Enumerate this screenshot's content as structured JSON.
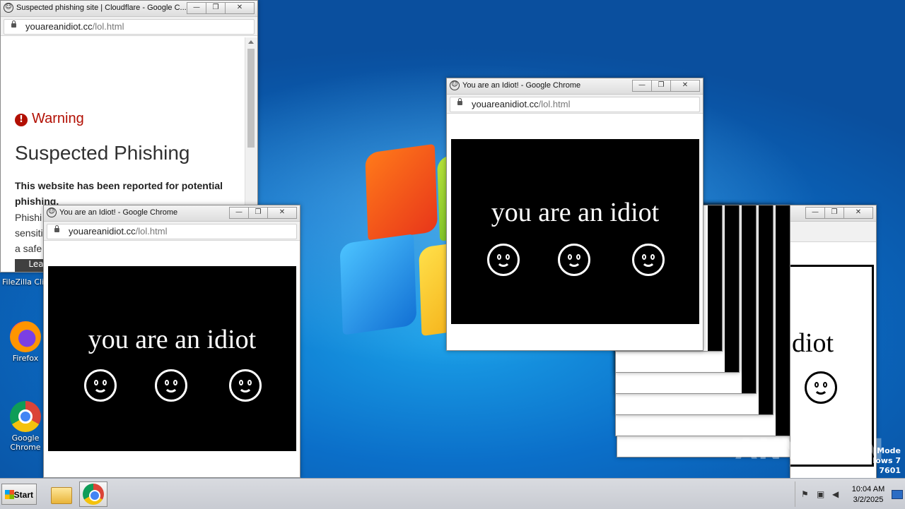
{
  "desktop": {
    "icons": [
      {
        "label": "FileZilla Clie",
        "icon": "filezilla-icon"
      },
      {
        "label": "Firefox",
        "icon": "firefox-icon"
      },
      {
        "label": "Google Chrome",
        "icon": "chrome-icon"
      }
    ],
    "watermark": "ANY RUN",
    "edition_lines": [
      "Mode",
      "lows 7",
      "ld 7601"
    ]
  },
  "phishing_window": {
    "title": "Suspected phishing site | Cloudflare - Google C...",
    "url_host": "youareanidiot.cc",
    "url_path": "/lol.html",
    "warning_label": "Warning",
    "heading": "Suspected Phishing",
    "description": "This website has been reported for potential phishing.",
    "more_text": "Phishi sensiti a safe",
    "button_label": "Lea"
  },
  "idiot_windows": [
    {
      "title": "You are an Idiot! - Google Chrome",
      "url_host": "youareanidiot.cc",
      "url_path": "/lol.html",
      "text": "you are an idiot"
    },
    {
      "title": "You are an Idiot! - Google Chrome",
      "url_host": "youareanidiot.cc",
      "url_path": "/lol.html",
      "text": "you are an idiot"
    }
  ],
  "stacked_window": {
    "text": "diot"
  },
  "window_buttons": {
    "minimize": "—",
    "maximize": "❐",
    "close": "✕"
  },
  "taskbar": {
    "start_label": "Start",
    "apps": [
      "explorer",
      "google-chrome"
    ],
    "clock_time": "10:04 AM",
    "clock_date": "3/2/2025"
  }
}
